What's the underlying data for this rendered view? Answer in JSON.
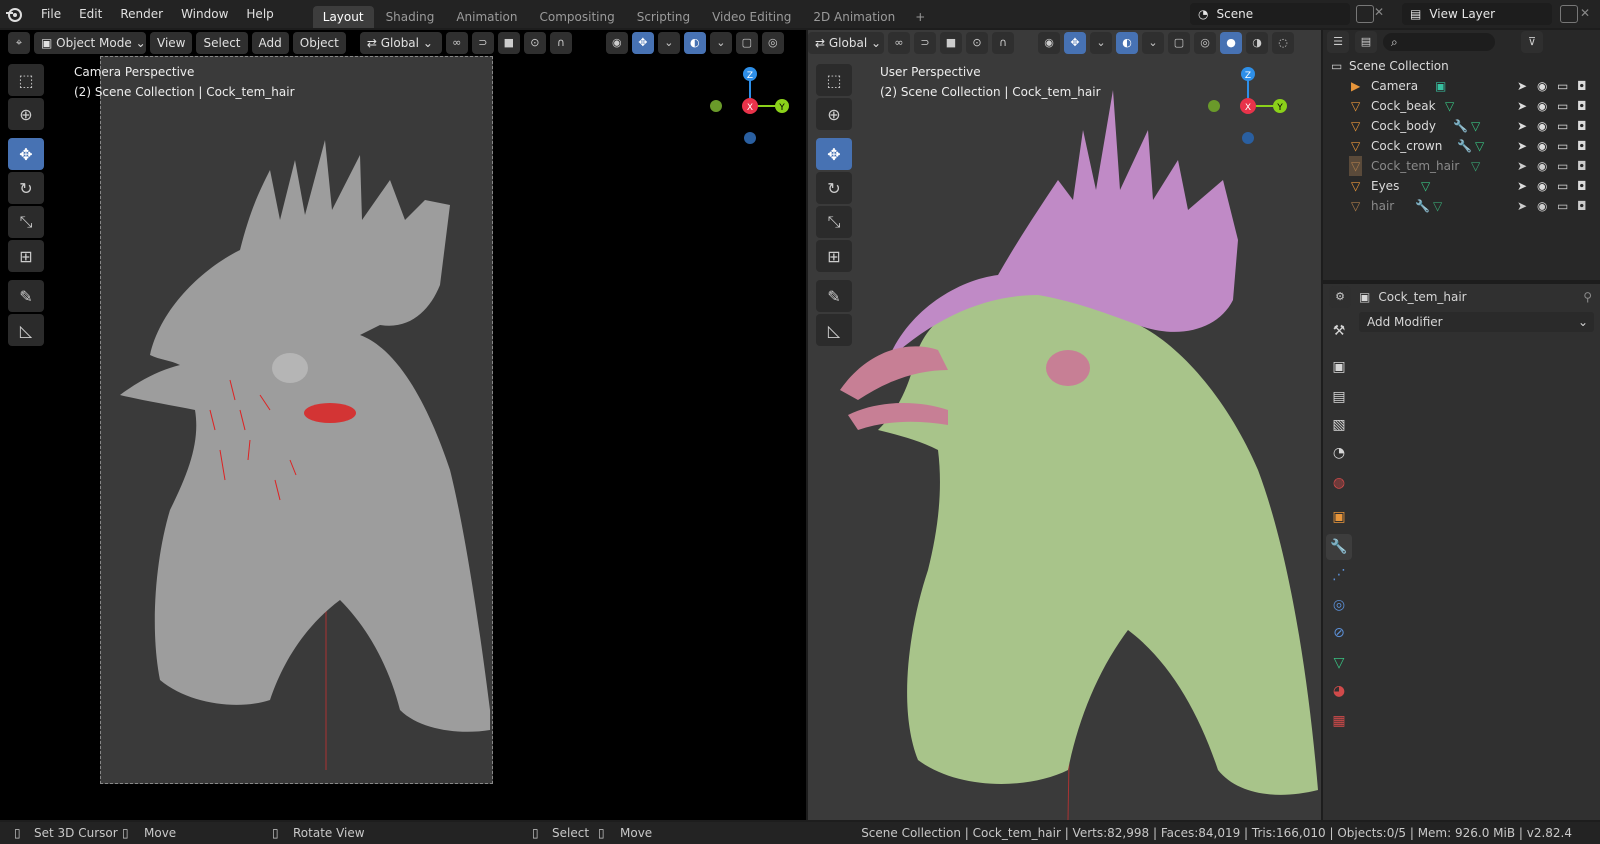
{
  "menu": [
    "File",
    "Edit",
    "Render",
    "Window",
    "Help"
  ],
  "tabs": [
    "Layout",
    "Shading",
    "Animation",
    "Compositing",
    "Scripting",
    "Video Editing",
    "2D Animation"
  ],
  "scene": "Scene",
  "view_layer": "View Layer",
  "left_header": {
    "mode": "Object Mode",
    "view": "View",
    "select": "Select",
    "add": "Add",
    "object": "Object",
    "transform": "Global"
  },
  "right_header": {
    "transform": "Global"
  },
  "left_vp": {
    "line1": "Camera Perspective",
    "line2": "(2) Scene Collection | Cock_tem_hair"
  },
  "right_vp": {
    "line1": "User Perspective",
    "line2": "(2) Scene Collection | Cock_tem_hair"
  },
  "gizmo": {
    "z": "Z",
    "x": "X",
    "y": "Y"
  },
  "outliner": {
    "root": "Scene Collection",
    "items": [
      "Camera",
      "Cock_beak",
      "Cock_body",
      "Cock_crown",
      "Cock_tem_hair",
      "Eyes",
      "hair"
    ]
  },
  "properties": {
    "object": "Cock_tem_hair",
    "add_modifier": "Add Modifier"
  },
  "status": {
    "set_cursor": "Set 3D Cursor",
    "move1": "Move",
    "rotate": "Rotate View",
    "select": "Select",
    "move2": "Move",
    "info": "Scene Collection | Cock_tem_hair | Verts:82,998 | Faces:84,019 | Tris:166,010 | Objects:0/5 | Mem: 926.0 MiB | v2.82.4"
  },
  "colors": {
    "accent": "#4772b3",
    "crown": "#c08ac6",
    "body": "#a8c48a",
    "beak": "#c77f95",
    "gray_model": "#9d9d9d",
    "x_axis": "#e8334a",
    "y_axis": "#8bd11a",
    "z_axis": "#2e8fe8"
  }
}
